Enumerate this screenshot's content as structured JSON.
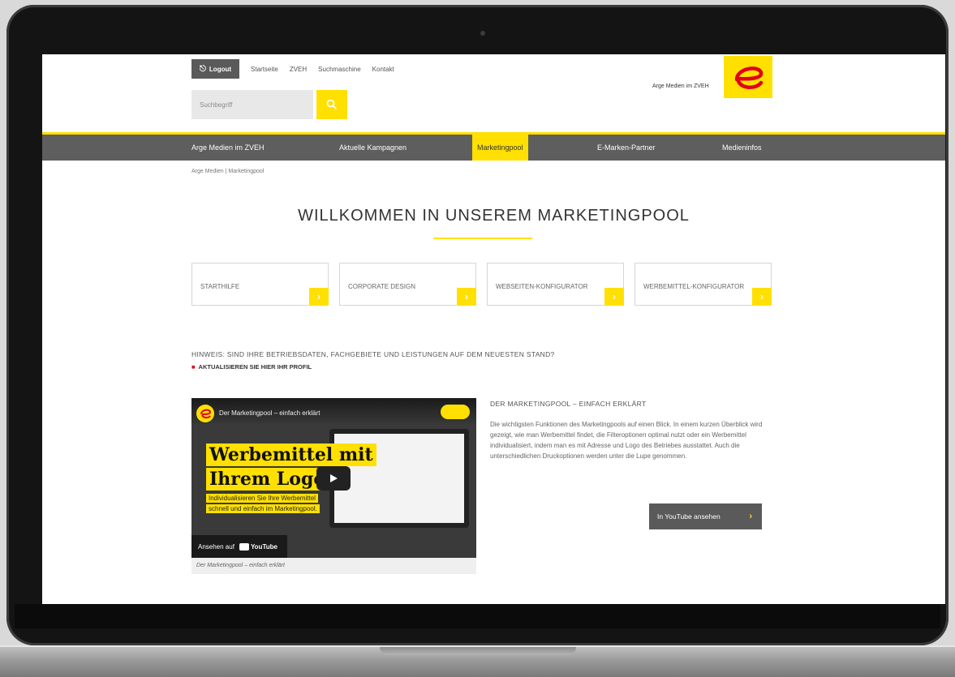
{
  "topbar": {
    "logout_label": "Logout",
    "links": [
      "Startseite",
      "ZVEH",
      "Suchmaschine",
      "Kontakt"
    ]
  },
  "search": {
    "placeholder": "Suchbegriff"
  },
  "brand": {
    "tagline": "Arge Medien im ZVEH"
  },
  "nav": {
    "items": [
      "Arge Medien im ZVEH",
      "Aktuelle Kampagnen",
      "Marketingpool",
      "E-Marken-Partner",
      "Medieninfos"
    ],
    "active_index": 2
  },
  "breadcrumb": "Arge Medien  |  Marketingpool",
  "page_title": "WILLKOMMEN IN UNSEREM MARKETINGPOOL",
  "cards": [
    {
      "label": "STARTHILFE"
    },
    {
      "label": "CORPORATE DESIGN"
    },
    {
      "label": "WEBSEITEN-KONFIGURATOR"
    },
    {
      "label": "WERBEMITTEL-KONFIGURATOR"
    }
  ],
  "hint": {
    "text": "HINWEIS: SIND IHRE BETRIEBSDATEN, FACHGEBIETE UND LEISTUNGEN AUF DEM NEUESTEN STAND?",
    "link": "AKTUALISIEREN SIE HIER IHR PROFIL"
  },
  "video": {
    "heading": "Der Marketingpool – einfach erklärt",
    "headline_1": "Werbemittel mit",
    "headline_2": "Ihrem Logo!",
    "subline_1": "Individualisieren Sie Ihre Werbemittel",
    "subline_2": "schnell und einfach im Marketingpool.",
    "watch_on": "Ansehen auf",
    "youtube_label": "YouTube",
    "caption": "Der Marketingpool – einfach erklärt"
  },
  "description": {
    "title": "DER MARKETINGPOOL – EINFACH ERKLÄRT",
    "text": "Die wichtigsten Funktionen des Marketingpools auf einen Blick. In einem kurzen Überblick wird gezeigt, wie man Werbemittel findet, die Filteroptionen optimal nutzt oder ein Werbemittel individualisiert, indem man es mit Adresse und Logo des Betriebes ausstattet. Auch die unterschiedlichen Druckoptionen werden unter die Lupe genommen.",
    "button": "In YouTube ansehen"
  },
  "colors": {
    "accent": "#ffe000",
    "nav_bg": "#5e5e5e",
    "bullet": "#e2001a"
  }
}
